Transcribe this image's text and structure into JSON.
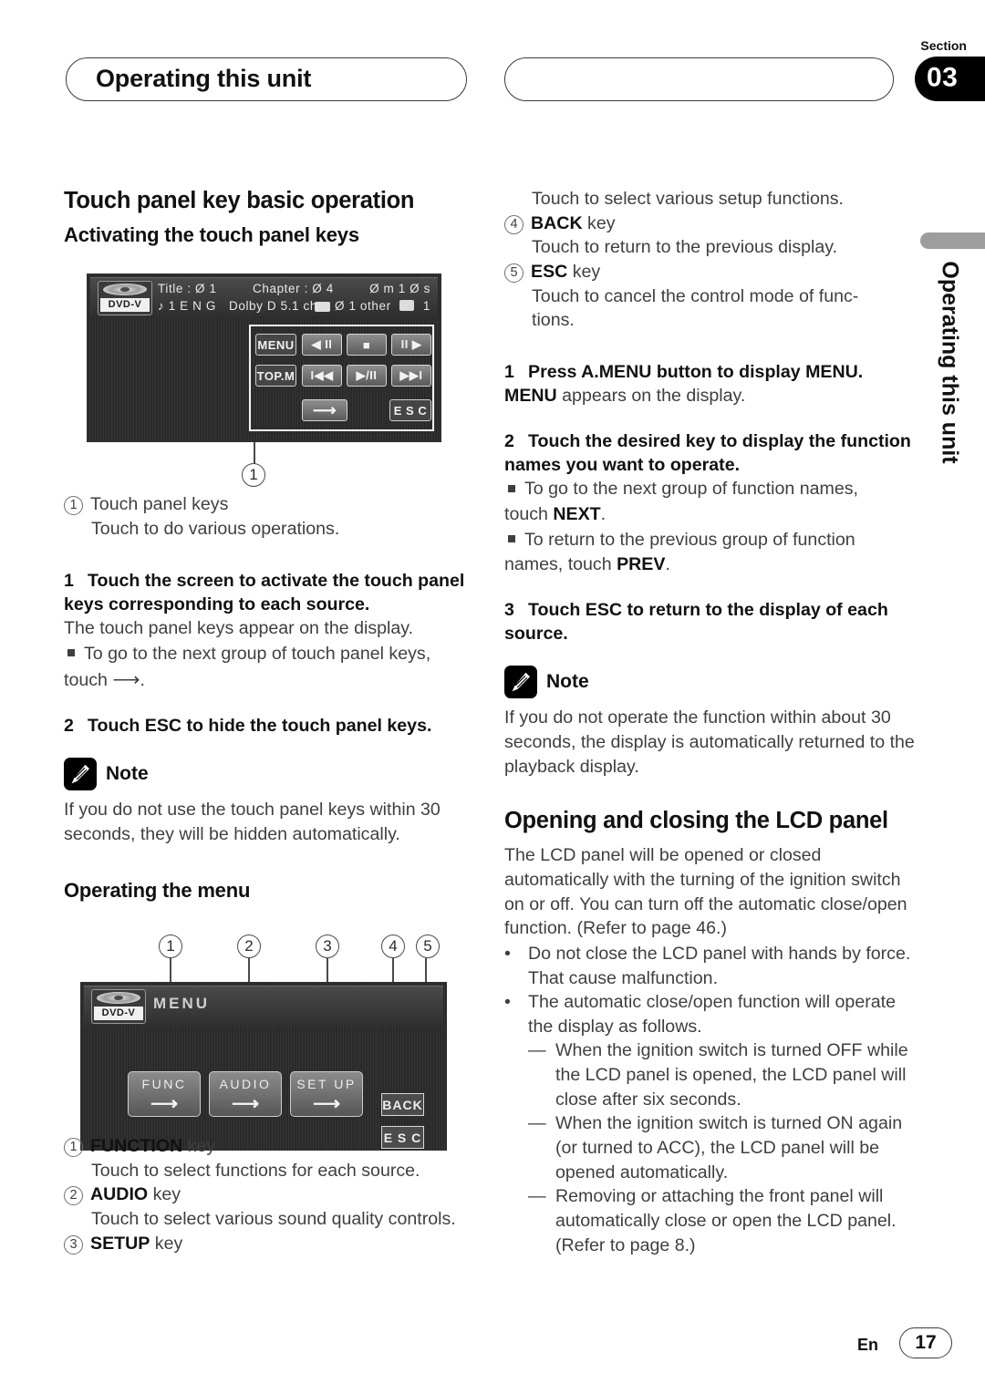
{
  "header": {
    "chapter_title": "Operating this unit",
    "section_label": "Section",
    "section_number": "03"
  },
  "side_tab": {
    "label": "Operating this unit"
  },
  "footer": {
    "language": "En",
    "page_number": "17"
  },
  "left_column": {
    "heading": "Touch panel key basic operation",
    "subheading_1": "Activating the touch panel keys",
    "figure1": {
      "badge_text": "DVD-V",
      "status_line_1": "Title : Ø 1          Chapter : Ø 4          Ø m 1 Ø s",
      "status_row_left": "Title : Ø 1",
      "status_row_mid": "Chapter : Ø 4",
      "status_row_right": "Ø m 1 Ø s",
      "status2_left": "♪ 1 E N G",
      "status2_mid": "Dolby D 5.1 ch",
      "status2_sub": "Ø 1 other",
      "status2_right": "1",
      "keys": {
        "menu": "MENU",
        "slow_rev": "◀ II",
        "stop": "■",
        "slow_fwd": "II ▶",
        "top_menu": "TOP.M",
        "prev_track": "I◀◀",
        "play_pause": "▶/II",
        "next_track": "▶▶I",
        "next_group": "⟶",
        "esc": "E S C"
      },
      "callout_1": "1"
    },
    "callout_list_1": [
      {
        "num": "1",
        "label": "Touch panel keys",
        "desc": "Touch to do various operations."
      }
    ],
    "step_1": {
      "num": "1",
      "text": "Touch the screen to activate the touch panel keys corresponding to each source."
    },
    "step_1_body": "The touch panel keys appear on the display.",
    "step_1_bullet_a": "To go to the next group of touch panel keys,",
    "step_1_bullet_a_tail_pre": "touch ",
    "step_1_bullet_a_tail_post": ".",
    "step_1_bullet_a_arrow": "⟶",
    "step_2": {
      "num": "2",
      "text": "Touch ESC to hide the touch panel keys."
    },
    "note_1": {
      "label": "Note",
      "text": "If you do not use the touch panel keys within 30 seconds, they will be hidden automatically."
    },
    "subheading_2": "Operating the menu",
    "figure2": {
      "badge_text": "DVD-V",
      "title": "MENU",
      "keys": {
        "func": "FUNC",
        "audio": "AUDIO",
        "setup": "SET UP",
        "back": "BACK",
        "esc": "E S C",
        "arrow": "⟶"
      },
      "callouts": [
        "1",
        "2",
        "3",
        "4",
        "5"
      ]
    },
    "key_list": [
      {
        "num": "1",
        "name": "FUNCTION",
        "suffix": " key",
        "desc": "Touch to select functions for each source."
      },
      {
        "num": "2",
        "name": "AUDIO",
        "suffix": " key",
        "desc": "Touch to select various sound quality controls."
      },
      {
        "num": "3",
        "name": "SETUP",
        "suffix": " key",
        "desc": ""
      }
    ]
  },
  "right_column": {
    "continued_desc": "Touch to select various setup functions.",
    "key_list": [
      {
        "num": "4",
        "name": "BACK",
        "suffix": " key",
        "desc": "Touch to return to the previous display."
      },
      {
        "num": "5",
        "name": "ESC",
        "suffix": " key",
        "desc": "Touch to cancel the control mode of func-tions."
      }
    ],
    "step_1": {
      "num": "1",
      "text": "Press A.MENU button to display MENU."
    },
    "step_1_body_bold": "MENU",
    "step_1_body_rest": " appears on the display.",
    "step_2": {
      "num": "2",
      "text": "Touch the desired key to display the function names you want to operate."
    },
    "step_2_bullet_a": "To go to the next group of function names,",
    "step_2_bullet_a_tail_pre": "touch ",
    "step_2_bullet_a_bold": "NEXT",
    "step_2_bullet_a_tail_post": ".",
    "step_2_bullet_b": "To return to the previous group of function",
    "step_2_bullet_b_tail_pre": "names, touch ",
    "step_2_bullet_b_bold": "PREV",
    "step_2_bullet_b_tail_post": ".",
    "step_3": {
      "num": "3",
      "text": "Touch ESC to return to the display of each source."
    },
    "note_1": {
      "label": "Note",
      "text": "If you do not operate the function within about 30 seconds, the display is automatically returned to the playback display."
    },
    "heading_2": "Opening and closing the LCD panel",
    "body_2": "The LCD panel will be opened or closed automatically with the turning of the ignition switch on or off. You can turn off the automatic close/open function. (Refer to page 46.)",
    "bullets": [
      "Do not close the LCD panel with hands by force. That cause malfunction.",
      "The automatic close/open function will operate the display as follows."
    ],
    "dash_items": [
      "When the ignition switch is turned OFF while the LCD panel is opened, the LCD panel will close after six seconds.",
      "When the ignition switch is turned ON again (or turned to ACC), the LCD panel will be opened automatically.",
      "Removing or attaching the front panel will automatically close or open the LCD panel. (Refer to page 8.)"
    ]
  }
}
